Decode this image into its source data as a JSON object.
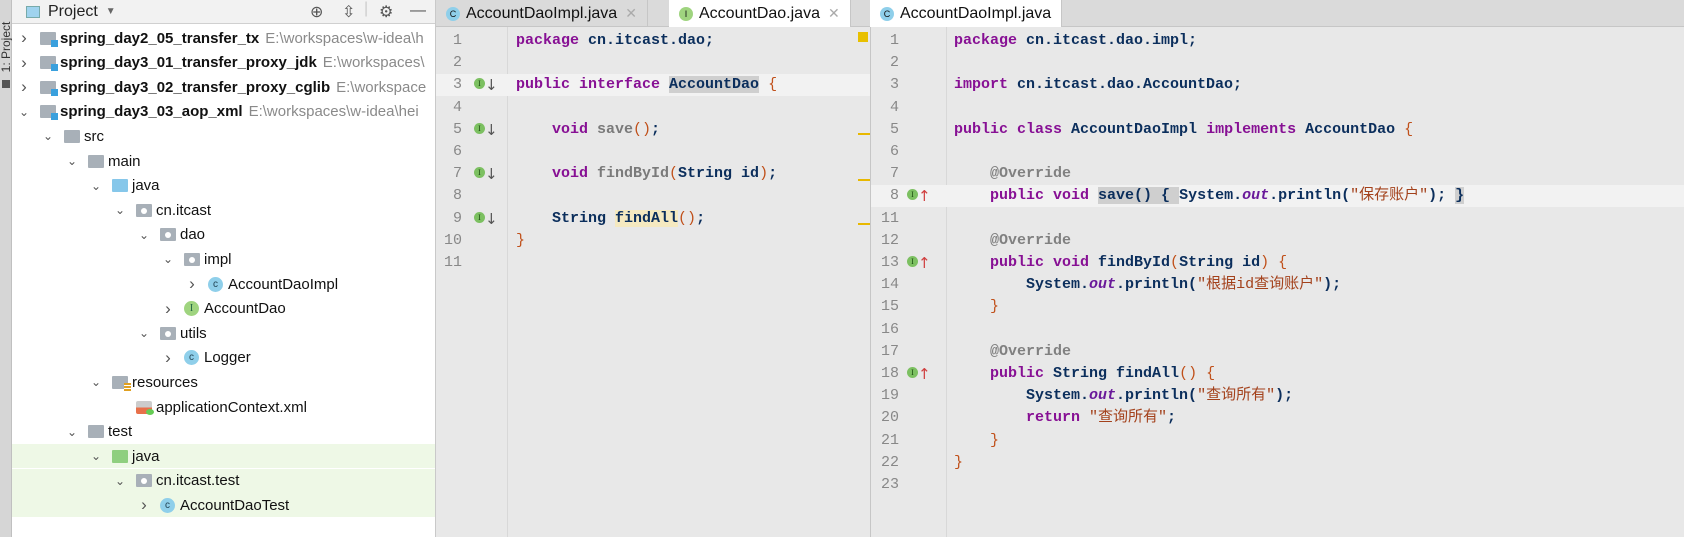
{
  "sidebar_strip": {
    "label": "1: Project"
  },
  "project": {
    "title": "Project",
    "tree": [
      {
        "name": "spring_day2_05_transfer_tx",
        "path": "E:\\workspaces\\w-idea\\h",
        "level": 0,
        "arrow": "›",
        "icon": "module",
        "bold": true
      },
      {
        "name": "spring_day3_01_transfer_proxy_jdk",
        "path": "E:\\workspaces\\",
        "level": 0,
        "arrow": "›",
        "icon": "module",
        "bold": true
      },
      {
        "name": "spring_day3_02_transfer_proxy_cglib",
        "path": "E:\\workspace",
        "level": 0,
        "arrow": "›",
        "icon": "module",
        "bold": true
      },
      {
        "name": "spring_day3_03_aop_xml",
        "path": "E:\\workspaces\\w-idea\\hei",
        "level": 0,
        "arrow": "⌄",
        "icon": "module",
        "bold": true
      },
      {
        "name": "src",
        "level": 1,
        "arrow": "⌄",
        "icon": "folder"
      },
      {
        "name": "main",
        "level": 2,
        "arrow": "⌄",
        "icon": "folder"
      },
      {
        "name": "java",
        "level": 3,
        "arrow": "⌄",
        "icon": "source-folder"
      },
      {
        "name": "cn.itcast",
        "level": 4,
        "arrow": "⌄",
        "icon": "package"
      },
      {
        "name": "dao",
        "level": 5,
        "arrow": "⌄",
        "icon": "package"
      },
      {
        "name": "impl",
        "level": 6,
        "arrow": "⌄",
        "icon": "package"
      },
      {
        "name": "AccountDaoImpl",
        "level": 7,
        "arrow": "›",
        "icon": "class"
      },
      {
        "name": "AccountDao",
        "level": 6,
        "arrow": "›",
        "icon": "interface"
      },
      {
        "name": "utils",
        "level": 5,
        "arrow": "⌄",
        "icon": "package"
      },
      {
        "name": "Logger",
        "level": 6,
        "arrow": "›",
        "icon": "class"
      },
      {
        "name": "resources",
        "level": 3,
        "arrow": "⌄",
        "icon": "resources"
      },
      {
        "name": "applicationContext.xml",
        "level": 4,
        "arrow": "",
        "icon": "xml"
      },
      {
        "name": "test",
        "level": 2,
        "arrow": "⌄",
        "icon": "folder"
      },
      {
        "name": "java",
        "level": 3,
        "arrow": "⌄",
        "icon": "test-folder",
        "green": true
      },
      {
        "name": "cn.itcast.test",
        "level": 4,
        "arrow": "⌄",
        "icon": "package",
        "green": true
      },
      {
        "name": "AccountDaoTest",
        "level": 5,
        "arrow": "›",
        "icon": "class",
        "green": true
      }
    ]
  },
  "left_tabs": [
    {
      "label": "AccountDaoImpl.java",
      "icon": "C",
      "active": false
    },
    {
      "label": "AccountDao.java",
      "icon": "I",
      "active": true
    }
  ],
  "right_tabs": [
    {
      "label": "AccountDaoImpl.java",
      "icon": "C",
      "active": true
    }
  ],
  "left_editor": {
    "caret_line": 3,
    "lines": [
      {
        "n": "1",
        "t": [
          [
            "package ",
            "k"
          ],
          [
            "cn.itcast.dao;",
            "i"
          ]
        ]
      },
      {
        "n": "2",
        "t": []
      },
      {
        "n": "3",
        "g": "down",
        "t": [
          [
            "public interface ",
            "k"
          ],
          [
            "AccountDao",
            "i hl"
          ],
          [
            " ",
            ""
          ],
          [
            "{",
            "p"
          ]
        ]
      },
      {
        "n": "4",
        "t": []
      },
      {
        "n": "5",
        "g": "down",
        "t": [
          [
            "    void ",
            "k"
          ],
          [
            "save",
            "m"
          ],
          [
            "()",
            "p"
          ],
          [
            ";",
            "i"
          ]
        ]
      },
      {
        "n": "6",
        "t": []
      },
      {
        "n": "7",
        "g": "down",
        "t": [
          [
            "    void ",
            "k"
          ],
          [
            "findById",
            "m"
          ],
          [
            "(",
            "p"
          ],
          [
            "String id",
            "i"
          ],
          [
            ")",
            "p"
          ],
          [
            ";",
            "i"
          ]
        ]
      },
      {
        "n": "8",
        "t": []
      },
      {
        "n": "9",
        "g": "down",
        "t": [
          [
            "    String ",
            "i"
          ],
          [
            "findAll",
            "i hy"
          ],
          [
            "()",
            "p"
          ],
          [
            ";",
            "i"
          ]
        ]
      },
      {
        "n": "10",
        "t": [
          [
            "}",
            "p"
          ]
        ]
      },
      {
        "n": "11",
        "t": []
      }
    ]
  },
  "right_editor": {
    "caret_line": "8",
    "lines": [
      {
        "n": "1",
        "t": [
          [
            "package ",
            "k"
          ],
          [
            "cn.itcast.dao.impl;",
            "i"
          ]
        ]
      },
      {
        "n": "2",
        "t": []
      },
      {
        "n": "3",
        "t": [
          [
            "import ",
            "k"
          ],
          [
            "cn.itcast.dao.AccountDao;",
            "i"
          ]
        ]
      },
      {
        "n": "4",
        "t": []
      },
      {
        "n": "5",
        "t": [
          [
            "public class ",
            "k"
          ],
          [
            "AccountDaoImpl ",
            "i"
          ],
          [
            "implements ",
            "k"
          ],
          [
            "AccountDao ",
            "i"
          ],
          [
            "{",
            "p"
          ]
        ]
      },
      {
        "n": "6",
        "t": []
      },
      {
        "n": "7",
        "t": [
          [
            "    @Override",
            "a"
          ]
        ]
      },
      {
        "n": "8",
        "g": "up",
        "t": [
          [
            "    public void ",
            "k"
          ],
          [
            "save",
            "i hl"
          ],
          [
            "() { ",
            "i hl"
          ],
          [
            "System.",
            "i"
          ],
          [
            "out",
            "o"
          ],
          [
            ".println(",
            "i"
          ],
          [
            "\"保存账户\"",
            "s"
          ],
          [
            ");",
            "i"
          ],
          [
            " ",
            ""
          ],
          [
            "}",
            "i hl"
          ]
        ]
      },
      {
        "n": "11",
        "t": []
      },
      {
        "n": "12",
        "t": [
          [
            "    @Override",
            "a"
          ]
        ]
      },
      {
        "n": "13",
        "g": "up",
        "t": [
          [
            "    public void ",
            "k"
          ],
          [
            "findById",
            "i"
          ],
          [
            "(",
            "p"
          ],
          [
            "String id",
            "i"
          ],
          [
            ") ",
            "p"
          ],
          [
            "{",
            "p"
          ]
        ]
      },
      {
        "n": "14",
        "t": [
          [
            "        System.",
            "i"
          ],
          [
            "out",
            "o"
          ],
          [
            ".println(",
            "i"
          ],
          [
            "\"根据id查询账户\"",
            "s"
          ],
          [
            ");",
            "i"
          ]
        ]
      },
      {
        "n": "15",
        "t": [
          [
            "    }",
            "p"
          ]
        ]
      },
      {
        "n": "16",
        "t": []
      },
      {
        "n": "17",
        "t": [
          [
            "    @Override",
            "a"
          ]
        ]
      },
      {
        "n": "18",
        "g": "up",
        "t": [
          [
            "    public ",
            "k"
          ],
          [
            "String findAll",
            "i"
          ],
          [
            "() ",
            "p"
          ],
          [
            "{",
            "p"
          ]
        ]
      },
      {
        "n": "19",
        "t": [
          [
            "        System.",
            "i"
          ],
          [
            "out",
            "o"
          ],
          [
            ".println(",
            "i"
          ],
          [
            "\"查询所有\"",
            "s"
          ],
          [
            ");",
            "i"
          ]
        ]
      },
      {
        "n": "20",
        "t": [
          [
            "        return ",
            "k"
          ],
          [
            "\"查询所有\"",
            "s"
          ],
          [
            ";",
            "i"
          ]
        ]
      },
      {
        "n": "21",
        "t": [
          [
            "    }",
            "p"
          ]
        ]
      },
      {
        "n": "22",
        "t": [
          [
            "}",
            "p"
          ]
        ]
      },
      {
        "n": "23",
        "t": []
      }
    ]
  },
  "colors": {
    "keyword": "#871094",
    "identifier": "#0b2e5c",
    "string": "#a3411b",
    "marker": "#e8b800",
    "test_bg": "#eef8e6"
  }
}
